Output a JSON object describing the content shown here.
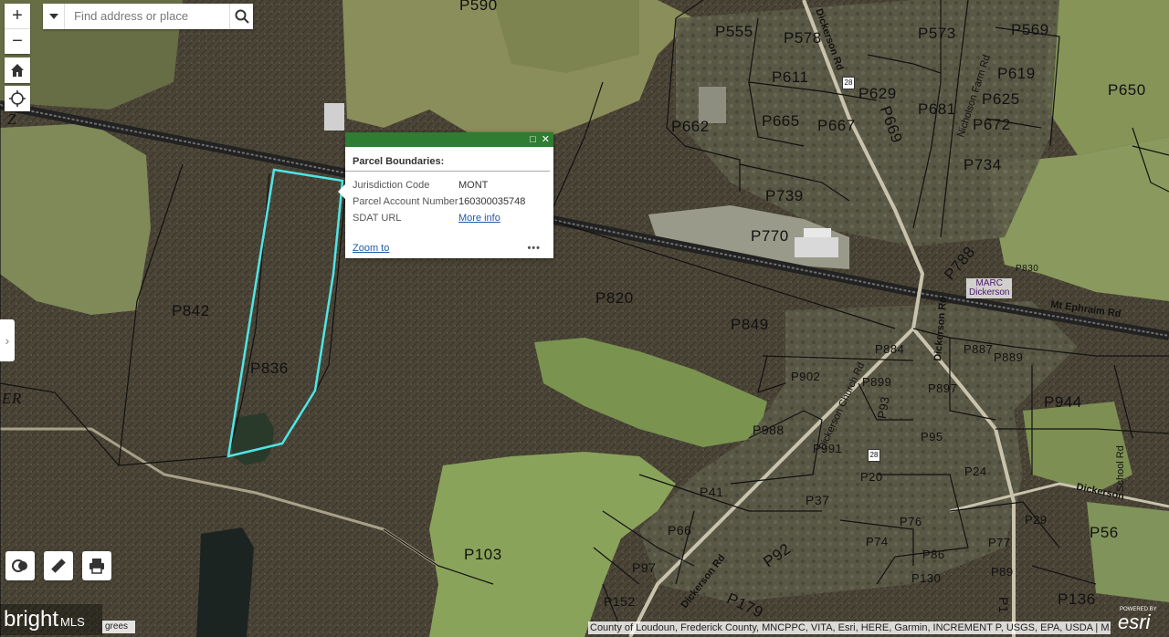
{
  "search": {
    "placeholder": "Find address or place"
  },
  "zoom": {
    "in_label": "+",
    "out_label": "−"
  },
  "popup": {
    "title": "Parcel Boundaries:",
    "fields": [
      {
        "key": "Jurisdiction Code",
        "value": "MONT"
      },
      {
        "key": "Parcel Account Number",
        "value": "160300035748"
      },
      {
        "key": "SDAT URL",
        "value": "More info"
      }
    ],
    "zoom_link": "Zoom to",
    "more": "•••"
  },
  "parcels": [
    "P590",
    "P555",
    "P578",
    "P573",
    "P569",
    "P650",
    "P619",
    "P611",
    "P629",
    "P625",
    "P625",
    "P662",
    "P665",
    "P667",
    "P681",
    "P672",
    "P669",
    "P734",
    "P739",
    "P770",
    "P788",
    "P830",
    "P842",
    "P836",
    "P820",
    "P849",
    "P884",
    "P887",
    "P889",
    "P902",
    "P899",
    "P897",
    "P944",
    "P988",
    "P991",
    "P95",
    "P93",
    "P20",
    "P24",
    "P41",
    "P37",
    "P29",
    "P56",
    "P66",
    "P76",
    "P74",
    "P77",
    "P86",
    "P92",
    "P97",
    "P89",
    "P103",
    "P130",
    "P136",
    "P152",
    "P179",
    "P1"
  ],
  "roads": [
    "Dickerson Rd",
    "Nicholson Farm Rd",
    "Mt Ephraim Rd",
    "Dickerson Rd",
    "Dickerson Church Rd",
    "Dickerson Rd",
    "Dickerson",
    "School Rd"
  ],
  "route_shield": "28",
  "marc": {
    "line1": "MARC",
    "line2": "Dickerson"
  },
  "map_letters": [
    "Z",
    "ER"
  ],
  "logo": {
    "brand": "bright",
    "suffix": "MLS"
  },
  "scale": "grees",
  "attribution": "County of Loudoun, Frederick County, MNCPPC, VITA, Esri, HERE, Garmin, INCREMENT P, USGS, EPA, USDA | M...",
  "esri": {
    "powered": "POWERED BY",
    "name": "esri"
  },
  "colors": {
    "popup_bar": "#2e7d32",
    "selection": "#4ee6e6",
    "link": "#1f5aa8"
  }
}
